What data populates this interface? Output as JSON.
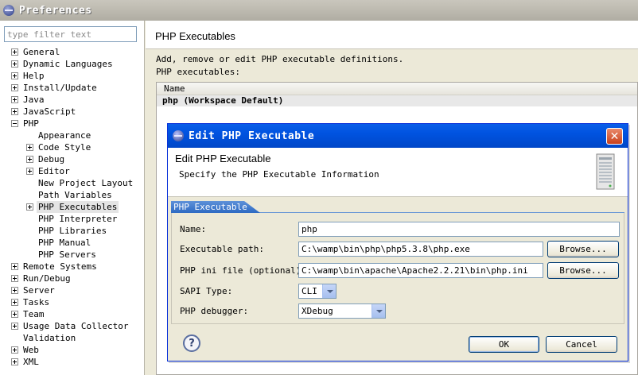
{
  "window": {
    "title": "Preferences"
  },
  "sidebar": {
    "filter_placeholder": "type filter text",
    "items": [
      {
        "label": "General",
        "level": 0,
        "expander": "plus"
      },
      {
        "label": "Dynamic Languages",
        "level": 0,
        "expander": "plus"
      },
      {
        "label": "Help",
        "level": 0,
        "expander": "plus"
      },
      {
        "label": "Install/Update",
        "level": 0,
        "expander": "plus"
      },
      {
        "label": "Java",
        "level": 0,
        "expander": "plus"
      },
      {
        "label": "JavaScript",
        "level": 0,
        "expander": "plus"
      },
      {
        "label": "PHP",
        "level": 0,
        "expander": "minus"
      },
      {
        "label": "Appearance",
        "level": 1,
        "expander": "none"
      },
      {
        "label": "Code Style",
        "level": 1,
        "expander": "plus"
      },
      {
        "label": "Debug",
        "level": 1,
        "expander": "plus"
      },
      {
        "label": "Editor",
        "level": 1,
        "expander": "plus"
      },
      {
        "label": "New Project Layout",
        "level": 1,
        "expander": "none"
      },
      {
        "label": "Path Variables",
        "level": 1,
        "expander": "none"
      },
      {
        "label": "PHP Executables",
        "level": 1,
        "expander": "plus",
        "selected": true
      },
      {
        "label": "PHP Interpreter",
        "level": 1,
        "expander": "none"
      },
      {
        "label": "PHP Libraries",
        "level": 1,
        "expander": "none"
      },
      {
        "label": "PHP Manual",
        "level": 1,
        "expander": "none"
      },
      {
        "label": "PHP Servers",
        "level": 1,
        "expander": "none"
      },
      {
        "label": "Remote Systems",
        "level": 0,
        "expander": "plus"
      },
      {
        "label": "Run/Debug",
        "level": 0,
        "expander": "plus"
      },
      {
        "label": "Server",
        "level": 0,
        "expander": "plus"
      },
      {
        "label": "Tasks",
        "level": 0,
        "expander": "plus"
      },
      {
        "label": "Team",
        "level": 0,
        "expander": "plus"
      },
      {
        "label": "Usage Data Collector",
        "level": 0,
        "expander": "plus"
      },
      {
        "label": "Validation",
        "level": 0,
        "expander": "none"
      },
      {
        "label": "Web",
        "level": 0,
        "expander": "plus"
      },
      {
        "label": "XML",
        "level": 0,
        "expander": "plus"
      }
    ]
  },
  "page": {
    "title": "PHP Executables",
    "description": "Add, remove or edit PHP executable definitions.",
    "executables_label": "PHP executables:",
    "table": {
      "columns": [
        "Name"
      ],
      "rows": [
        {
          "name": "php (Workspace Default)"
        }
      ]
    }
  },
  "dialog": {
    "title": "Edit PHP Executable",
    "heading": "Edit PHP Executable",
    "subheading": "Specify the PHP Executable Information",
    "tab": "PHP Executable",
    "fields": {
      "name_label": "Name:",
      "name_value": "php",
      "exec_label": "Executable path:",
      "exec_value": "C:\\wamp\\bin\\php\\php5.3.8\\php.exe",
      "ini_label": "PHP ini file (optional):",
      "ini_value": "C:\\wamp\\bin\\apache\\Apache2.2.21\\bin\\php.ini",
      "sapi_label": "SAPI Type:",
      "sapi_value": "CLI",
      "debugger_label": "PHP debugger:",
      "debugger_value": "XDebug"
    },
    "browse_label": "Browse...",
    "ok_label": "OK",
    "cancel_label": "Cancel",
    "help_symbol": "?",
    "close_symbol": "✕"
  },
  "colors": {
    "dialog_title": "#0053e0",
    "tab": "#3a78cc",
    "window_bg": "#ece9d8"
  }
}
